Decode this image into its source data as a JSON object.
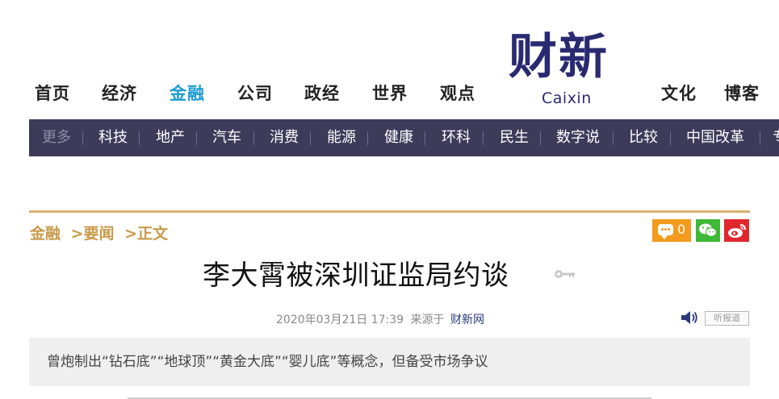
{
  "top_nav": {
    "items": [
      "首页",
      "经济",
      "金融",
      "公司",
      "政经",
      "世界",
      "观点"
    ],
    "right_items": [
      "文化",
      "博客"
    ],
    "active": "金融"
  },
  "logo": {
    "cn": "财新",
    "en": "Caixin"
  },
  "sub_nav": {
    "more": "更多",
    "items": [
      "科技",
      "地产",
      "汽车",
      "消费",
      "能源",
      "健康",
      "环科",
      "民生",
      "数字说",
      "比较",
      "中国改革",
      "专"
    ]
  },
  "breadcrumb": {
    "section": "金融",
    "sub": ">要闻",
    "current": ">正文"
  },
  "share": {
    "comment_count": "0"
  },
  "article": {
    "title": "李大霄被深圳证监局约谈",
    "date": "2020年03月21日 17:39",
    "source_prefix": "来源于",
    "source": "财新网",
    "listen_label": "听报道",
    "summary": "曾炮制出“钻石底”“地球顶”“黄金大底”“婴儿底”等概念，但备受市场争议"
  },
  "colors": {
    "nav_active": "#1b9bd0",
    "subnav_bg": "#3c3b5a",
    "breadcrumb": "#c99a4a",
    "gold_rule": "#d8b26e",
    "logo": "#2a2a72"
  },
  "icons": [
    "comment-icon",
    "wechat-icon",
    "weibo-icon",
    "key-icon",
    "speaker-icon"
  ]
}
